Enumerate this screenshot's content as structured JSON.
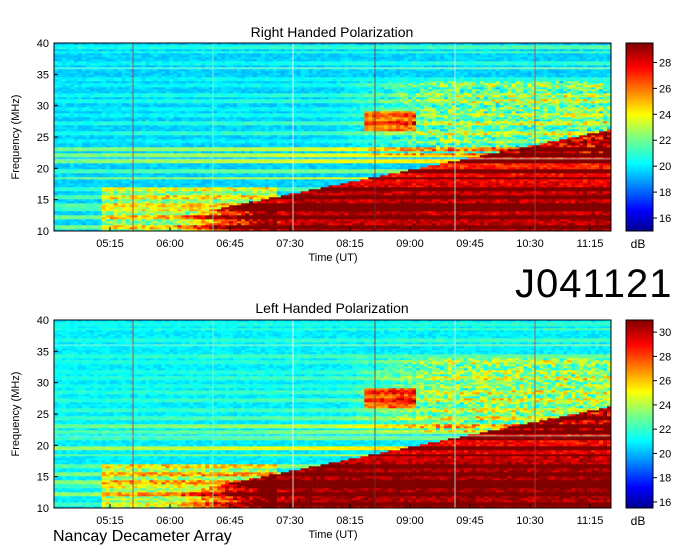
{
  "observation_id": "J041121",
  "footer": "Nancay Decameter Array",
  "chart_data": [
    {
      "type": "heatmap",
      "title": "Right Handed Polarization",
      "xlabel": "Time (UT)",
      "ylabel": "Frequency (MHz)",
      "x_ticks": [
        "05:15",
        "06:00",
        "06:45",
        "07:30",
        "08:15",
        "09:00",
        "09:45",
        "10:30",
        "11:15"
      ],
      "y_ticks": [
        10,
        15,
        20,
        25,
        30,
        35,
        40
      ],
      "ylim": [
        10,
        40
      ],
      "colorbar": {
        "label": "dB",
        "ticks": [
          16,
          18,
          20,
          22,
          24,
          26,
          28
        ],
        "range": [
          15,
          29.5
        ]
      }
    },
    {
      "type": "heatmap",
      "title": "Left Handed Polarization",
      "xlabel": "Time (UT)",
      "ylabel": "Frequency (MHz)",
      "x_ticks": [
        "05:15",
        "06:00",
        "06:45",
        "07:30",
        "08:15",
        "09:00",
        "09:45",
        "10:30",
        "11:15"
      ],
      "y_ticks": [
        10,
        15,
        20,
        25,
        30,
        35,
        40
      ],
      "ylim": [
        10,
        40
      ],
      "colorbar": {
        "label": "dB",
        "ticks": [
          16,
          18,
          20,
          22,
          24,
          26,
          28,
          30
        ],
        "range": [
          15.5,
          31
        ]
      }
    }
  ]
}
